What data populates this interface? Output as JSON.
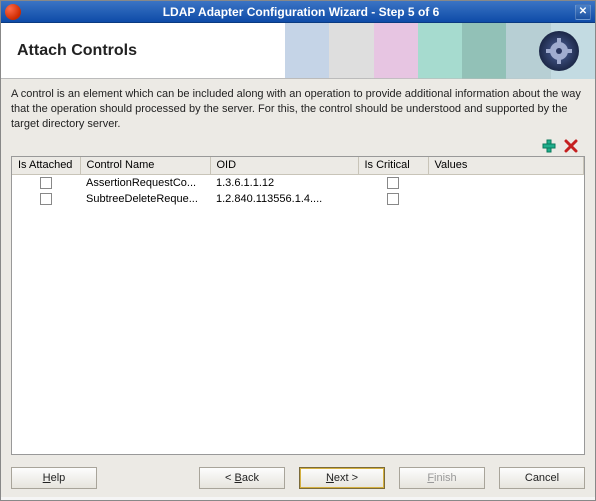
{
  "window": {
    "title": "LDAP Adapter Configuration Wizard - Step 5 of 6"
  },
  "banner": {
    "title": "Attach Controls"
  },
  "instructions": "A control is an element which can be included along with an operation to provide additional information about the way that the operation should processed by the server. For this, the control should be understood and supported by the target directory server.",
  "icons": {
    "add": "add-icon",
    "remove": "remove-icon"
  },
  "table": {
    "headers": {
      "attached": "Is Attached",
      "name": "Control Name",
      "oid": "OID",
      "critical": "Is Critical",
      "values": "Values"
    },
    "rows": [
      {
        "attached": false,
        "name": "AssertionRequestCo...",
        "oid": "1.3.6.1.1.12",
        "critical": false,
        "values": ""
      },
      {
        "attached": false,
        "name": "SubtreeDeleteReque...",
        "oid": "1.2.840.113556.1.4....",
        "critical": false,
        "values": ""
      }
    ]
  },
  "buttons": {
    "help": {
      "label": "Help",
      "mnemonic": "H"
    },
    "back": {
      "label": "Back",
      "mnemonic": "B",
      "prefix": "< "
    },
    "next": {
      "label": "Next",
      "mnemonic": "N",
      "suffix": " >"
    },
    "finish": {
      "label": "Finish",
      "mnemonic": "F",
      "disabled": true
    },
    "cancel": {
      "label": "Cancel"
    }
  }
}
